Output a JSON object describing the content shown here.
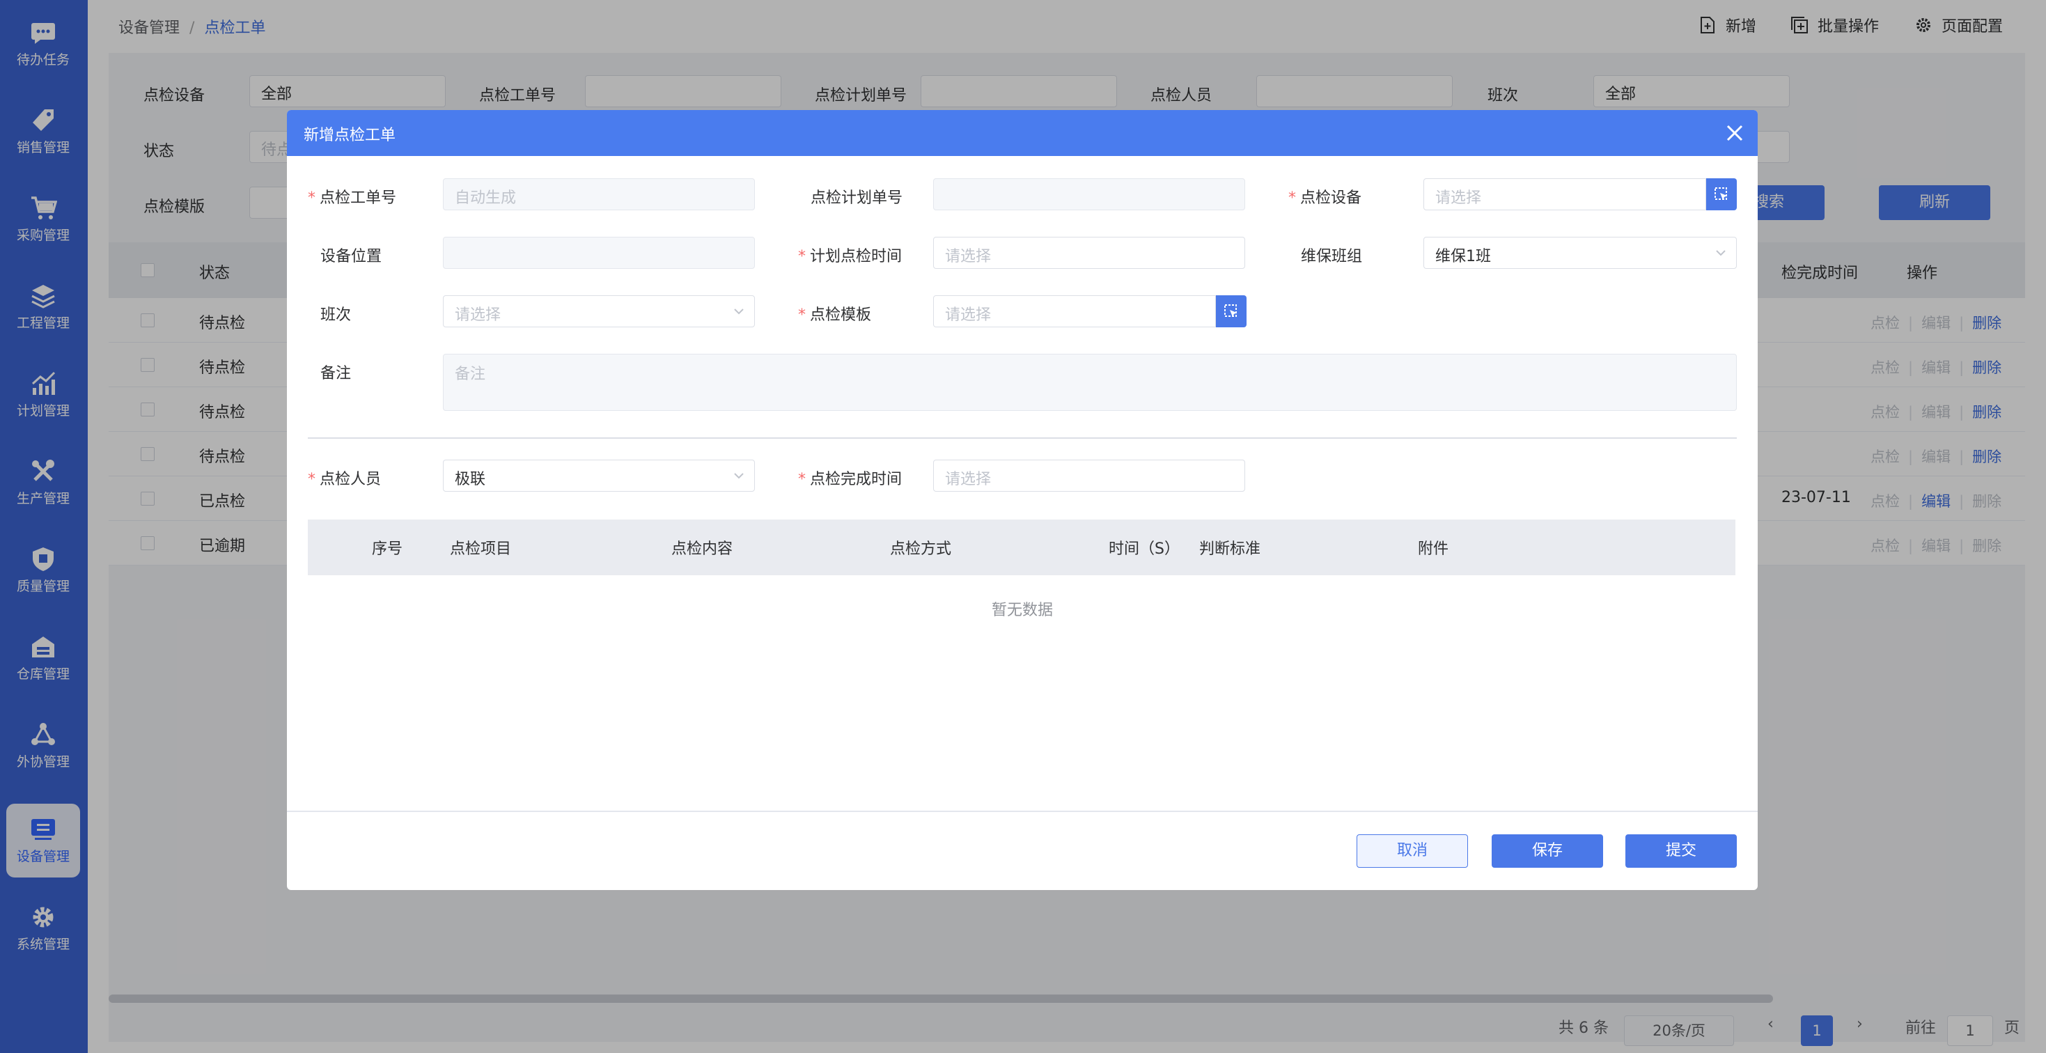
{
  "sidebar": {
    "items": [
      {
        "label": "待办任务",
        "icon": "chat-icon"
      },
      {
        "label": "销售管理",
        "icon": "tag-icon"
      },
      {
        "label": "采购管理",
        "icon": "cart-icon"
      },
      {
        "label": "工程管理",
        "icon": "layers-icon"
      },
      {
        "label": "计划管理",
        "icon": "chart-icon"
      },
      {
        "label": "生产管理",
        "icon": "tools-icon"
      },
      {
        "label": "质量管理",
        "icon": "shield-icon"
      },
      {
        "label": "仓库管理",
        "icon": "warehouse-icon"
      },
      {
        "label": "外协管理",
        "icon": "network-icon"
      },
      {
        "label": "设备管理",
        "icon": "device-icon"
      },
      {
        "label": "系统管理",
        "icon": "gear-icon"
      }
    ],
    "active": "设备管理"
  },
  "breadcrumb": {
    "parent": "设备管理",
    "sep": "/",
    "current": "点检工单"
  },
  "topActions": {
    "add": "新增",
    "batch": "批量操作",
    "config": "页面配置"
  },
  "filters": {
    "device": {
      "label": "点检设备",
      "value": "全部"
    },
    "orderNo": {
      "label": "点检工单号",
      "value": ""
    },
    "planNo": {
      "label": "点检计划单号",
      "value": ""
    },
    "person": {
      "label": "点检人员",
      "value": ""
    },
    "shift": {
      "label": "班次",
      "value": "全部"
    },
    "status": {
      "label": "状态",
      "value": "待点"
    },
    "template": {
      "label": "点检模版",
      "value": ""
    },
    "search": "搜索",
    "refresh": "刷新"
  },
  "table": {
    "headers": {
      "status": "状态",
      "finish": "检完成时间",
      "ops": "操作"
    },
    "rows": [
      {
        "status": "待点检",
        "finish": "",
        "op1": "点检",
        "op2": "编辑",
        "op3": "删除"
      },
      {
        "status": "待点检",
        "finish": "",
        "op1": "点检",
        "op2": "编辑",
        "op3": "删除"
      },
      {
        "status": "待点检",
        "finish": "",
        "op1": "点检",
        "op2": "编辑",
        "op3": "删除"
      },
      {
        "status": "待点检",
        "finish": "",
        "op1": "点检",
        "op2": "编辑",
        "op3": "删除"
      },
      {
        "status": "已点检",
        "finish": "23-07-11",
        "op1": "点检",
        "op2": "编辑",
        "op3": "删除"
      },
      {
        "status": "已逾期",
        "finish": "",
        "op1": "点检",
        "op2": "编辑",
        "op3": "删除"
      }
    ]
  },
  "pagination": {
    "total": "共 6 条",
    "size": "20条/页",
    "page": "1",
    "goto": "前往",
    "gotoValue": "1",
    "pageUnit": "页"
  },
  "modal": {
    "title": "新增点检工单",
    "form": {
      "orderNo": {
        "label": "点检工单号",
        "placeholder": "自动生成"
      },
      "planNo": {
        "label": "点检计划单号",
        "value": ""
      },
      "device": {
        "label": "点检设备",
        "placeholder": "请选择"
      },
      "location": {
        "label": "设备位置",
        "value": ""
      },
      "planTime": {
        "label": "计划点检时间",
        "placeholder": "请选择"
      },
      "team": {
        "label": "维保班组",
        "value": "维保1班"
      },
      "shift": {
        "label": "班次",
        "placeholder": "请选择"
      },
      "template": {
        "label": "点检模板",
        "placeholder": "请选择"
      },
      "remark": {
        "label": "备注",
        "placeholder": "备注"
      },
      "inspector": {
        "label": "点检人员",
        "value": "极联"
      },
      "finishTime": {
        "label": "点检完成时间",
        "placeholder": "请选择"
      }
    },
    "table": {
      "headers": [
        "序号",
        "点检项目",
        "点检内容",
        "点检方式",
        "时间（S）",
        "判断标准",
        "附件"
      ],
      "empty": "暂无数据"
    },
    "buttons": {
      "cancel": "取消",
      "save": "保存",
      "submit": "提交"
    }
  }
}
